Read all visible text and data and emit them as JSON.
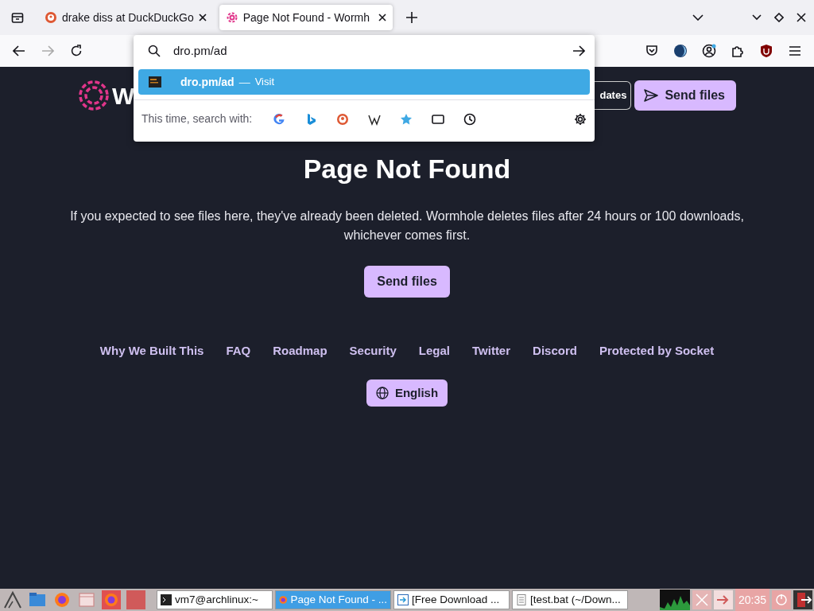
{
  "tabs": [
    {
      "title": "drake diss at DuckDuckGo",
      "kind": "duckduckgo",
      "selected": false
    },
    {
      "title": "Page Not Found - Wormh",
      "kind": "wormhole",
      "selected": true
    }
  ],
  "urlbar": {
    "value": "dro.pm/ad",
    "suggestions": [
      {
        "title": "dro.pm/ad",
        "separator": "—",
        "action": "Visit",
        "selected": true
      }
    ],
    "search_with_label": "This time, search with:"
  },
  "page": {
    "logo_text": "W",
    "header_buttons": [
      {
        "label": "dates",
        "kind": "outline"
      },
      {
        "label": "Send files",
        "kind": "primary"
      }
    ],
    "heading": "Page Not Found",
    "message": "If you expected to see files here, they've already been deleted. Wormhole deletes files after 24 hours or 100 downloads, whichever comes first.",
    "cta": "Send files",
    "footer_links": [
      "Why We Built This",
      "FAQ",
      "Roadmap",
      "Security",
      "Legal",
      "Twitter",
      "Discord",
      "Protected by Socket"
    ],
    "language": "English"
  },
  "taskbar": {
    "tasks": [
      {
        "label": "vm7@archlinux:~",
        "kind": "terminal",
        "selected": false
      },
      {
        "label": "Page Not Found - ...",
        "kind": "browser",
        "selected": true
      },
      {
        "label": "[Free Download ...",
        "kind": "download",
        "selected": false
      },
      {
        "label": "[test.bat (~/Down...",
        "kind": "document",
        "selected": false
      }
    ],
    "clock": "20:35"
  }
}
